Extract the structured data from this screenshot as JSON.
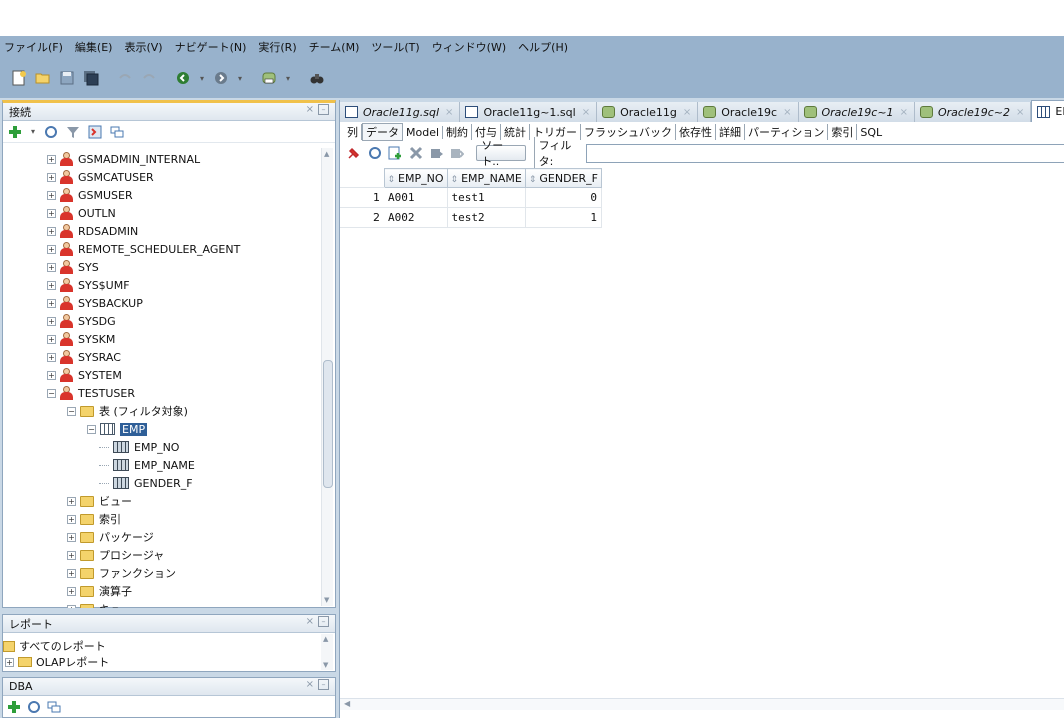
{
  "menubar": [
    "ファイル(F)",
    "編集(E)",
    "表示(V)",
    "ナビゲート(N)",
    "実行(R)",
    "チーム(M)",
    "ツール(T)",
    "ウィンドウ(W)",
    "ヘルプ(H)"
  ],
  "toolbar_icons": [
    "new-icon",
    "open-icon",
    "save-icon",
    "save-all-icon",
    "undo-icon",
    "redo-icon",
    "back-icon",
    "forward-icon",
    "sql-connection-icon",
    "binoculars-icon"
  ],
  "connections_panel": {
    "title": "接続",
    "tree": [
      {
        "label": "GSMADMIN_INTERNAL",
        "type": "user"
      },
      {
        "label": "GSMCATUSER",
        "type": "user"
      },
      {
        "label": "GSMUSER",
        "type": "user"
      },
      {
        "label": "OUTLN",
        "type": "user"
      },
      {
        "label": "RDSADMIN",
        "type": "user"
      },
      {
        "label": "REMOTE_SCHEDULER_AGENT",
        "type": "user"
      },
      {
        "label": "SYS",
        "type": "user"
      },
      {
        "label": "SYS$UMF",
        "type": "user"
      },
      {
        "label": "SYSBACKUP",
        "type": "user"
      },
      {
        "label": "SYSDG",
        "type": "user"
      },
      {
        "label": "SYSKM",
        "type": "user"
      },
      {
        "label": "SYSRAC",
        "type": "user"
      },
      {
        "label": "SYSTEM",
        "type": "user"
      },
      {
        "label": "TESTUSER",
        "type": "user"
      },
      {
        "label": "表 (フィルタ対象)",
        "type": "folder"
      },
      {
        "label": "EMP",
        "type": "table"
      },
      {
        "label": "EMP_NO",
        "type": "column"
      },
      {
        "label": "EMP_NAME",
        "type": "column"
      },
      {
        "label": "GENDER_F",
        "type": "column"
      },
      {
        "label": "ビュー",
        "type": "folder"
      },
      {
        "label": "索引",
        "type": "folder"
      },
      {
        "label": "パッケージ",
        "type": "folder"
      },
      {
        "label": "プロシージャ",
        "type": "folder"
      },
      {
        "label": "ファンクション",
        "type": "folder"
      },
      {
        "label": "演算子",
        "type": "folder"
      },
      {
        "label": "キュー",
        "type": "folder"
      }
    ]
  },
  "reports_panel": {
    "title": "レポート",
    "items": [
      "すべてのレポート",
      "OLAPレポート"
    ]
  },
  "dba_panel": {
    "title": "DBA"
  },
  "editor": {
    "tabs": [
      {
        "label": "Oracle11g.sql",
        "icon": "sql",
        "italic": true
      },
      {
        "label": "Oracle11g~1.sql",
        "icon": "sql",
        "italic": false
      },
      {
        "label": "Oracle11g",
        "icon": "conn",
        "italic": false
      },
      {
        "label": "Oracle19c",
        "icon": "conn",
        "italic": false
      },
      {
        "label": "Oracle19c~1",
        "icon": "conn",
        "italic": true
      },
      {
        "label": "Oracle19c~2",
        "icon": "conn",
        "italic": true
      },
      {
        "label": "EMP",
        "icon": "tbl",
        "italic": false,
        "active": true
      }
    ],
    "subtabs": [
      "列",
      "データ",
      "Model",
      "制約",
      "付与",
      "統計",
      "トリガー",
      "フラッシュバック",
      "依存性",
      "詳細",
      "パーティション",
      "索引",
      "SQL"
    ],
    "active_subtab": "データ",
    "sort_label": "ソート..",
    "filter_label": "フィルタ:",
    "filter_value": "",
    "grid": {
      "columns": [
        "EMP_NO",
        "EMP_NAME",
        "GENDER_F"
      ],
      "rows": [
        {
          "n": "1",
          "cells": [
            "A001",
            "test1",
            "0"
          ]
        },
        {
          "n": "2",
          "cells": [
            "A002",
            "test2",
            "1"
          ]
        }
      ]
    }
  }
}
